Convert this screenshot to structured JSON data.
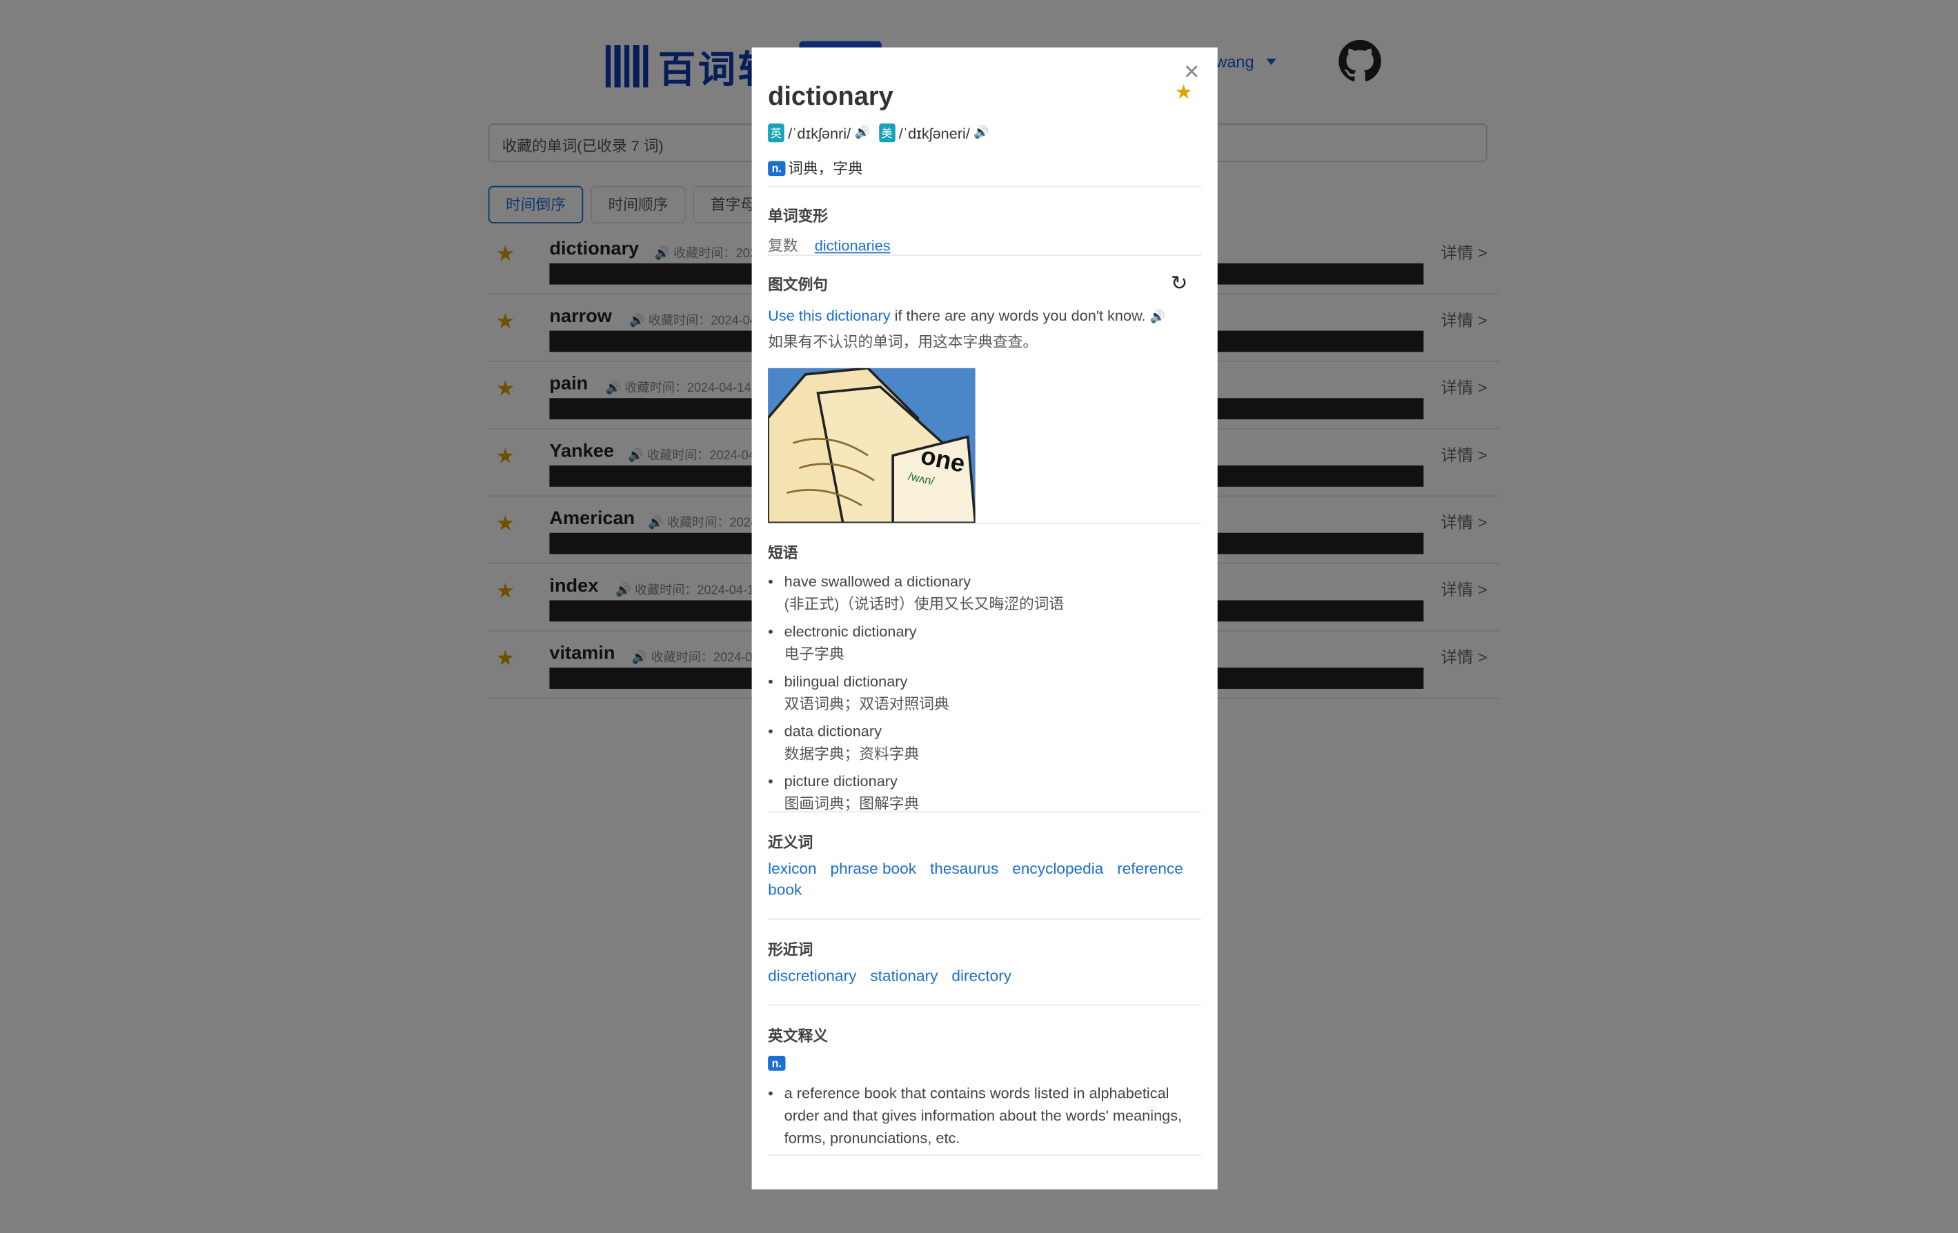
{
  "header": {
    "logo_text": "百词斩",
    "user_name": "jonwhy.wang"
  },
  "search": {
    "label": "收藏的单词(已收录 7 词)"
  },
  "sort_tabs": [
    "时间倒序",
    "时间顺序",
    "首字母顺序"
  ],
  "words": [
    {
      "word": "dictionary",
      "meta": "收藏时间：2024-04-14",
      "detail": "详情 >"
    },
    {
      "word": "narrow",
      "meta": "收藏时间：2024-04-14",
      "detail": "详情 >"
    },
    {
      "word": "pain",
      "meta": "收藏时间：2024-04-14",
      "detail": "详情 >"
    },
    {
      "word": "Yankee",
      "meta": "收藏时间：2024-04-14",
      "detail": "详情 >"
    },
    {
      "word": "American",
      "meta": "收藏时间：2024-04-14",
      "detail": "详情 >"
    },
    {
      "word": "index",
      "meta": "收藏时间：2024-04-14",
      "detail": "详情 >"
    },
    {
      "word": "vitamin",
      "meta": "收藏时间：2024-04-14",
      "detail": "详情 >"
    }
  ],
  "modal": {
    "word": "dictionary",
    "uk_flag": "英",
    "uk_phonetic": "/ˈdɪkʃənri/",
    "us_flag": "美",
    "us_phonetic": "/ˈdɪkʃəneri/",
    "pos": "n.",
    "meaning": "词典，字典",
    "forms_title": "单词变形",
    "forms_label": "复数",
    "forms_value": "dictionaries",
    "example_title": "图文例句",
    "example_highlight": "Use this dictionary",
    "example_rest": " if there are any words you don't know.",
    "example_zh": "如果有不认识的单词，用这本字典查查。",
    "phrases_title": "短语",
    "phrases": [
      {
        "en": "have swallowed a dictionary",
        "zh": "(非正式)（说话时）使用又长又晦涩的词语"
      },
      {
        "en": "electronic dictionary",
        "zh": "电子字典"
      },
      {
        "en": "bilingual dictionary",
        "zh": "双语词典；双语对照词典"
      },
      {
        "en": "data dictionary",
        "zh": "数据字典；资料字典"
      },
      {
        "en": "picture dictionary",
        "zh": "图画词典；图解字典"
      }
    ],
    "synonyms_title": "近义词",
    "synonyms": [
      "lexicon",
      "phrase book",
      "thesaurus",
      "encyclopedia",
      "reference book"
    ],
    "similar_title": "形近词",
    "similar": [
      "discretionary",
      "stationary",
      "directory"
    ],
    "english_def_title": "英文释义",
    "english_def_pos": "n.",
    "english_def": "a reference book that contains words listed in alphabetical order and that gives information about the words' meanings, forms, pronunciations, etc.",
    "image_text": "one",
    "image_phonetic": "/wʌn/"
  }
}
